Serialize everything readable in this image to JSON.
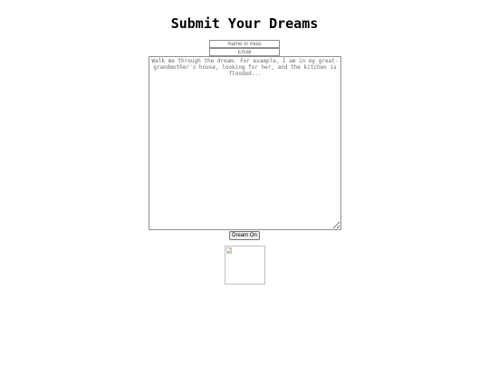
{
  "page": {
    "title": "Submit Your Dreams"
  },
  "form": {
    "name_placeholder": "Name or Alias",
    "name_value": "",
    "email_placeholder": "Email",
    "email_value": "",
    "dream_placeholder": "Walk me through the dream. For example, I am in my great-grandmother's house, looking for her, and the kitchen is flooded...",
    "dream_value": "",
    "submit_label": "Dream On"
  },
  "image": {
    "icon": "broken-image-icon"
  }
}
